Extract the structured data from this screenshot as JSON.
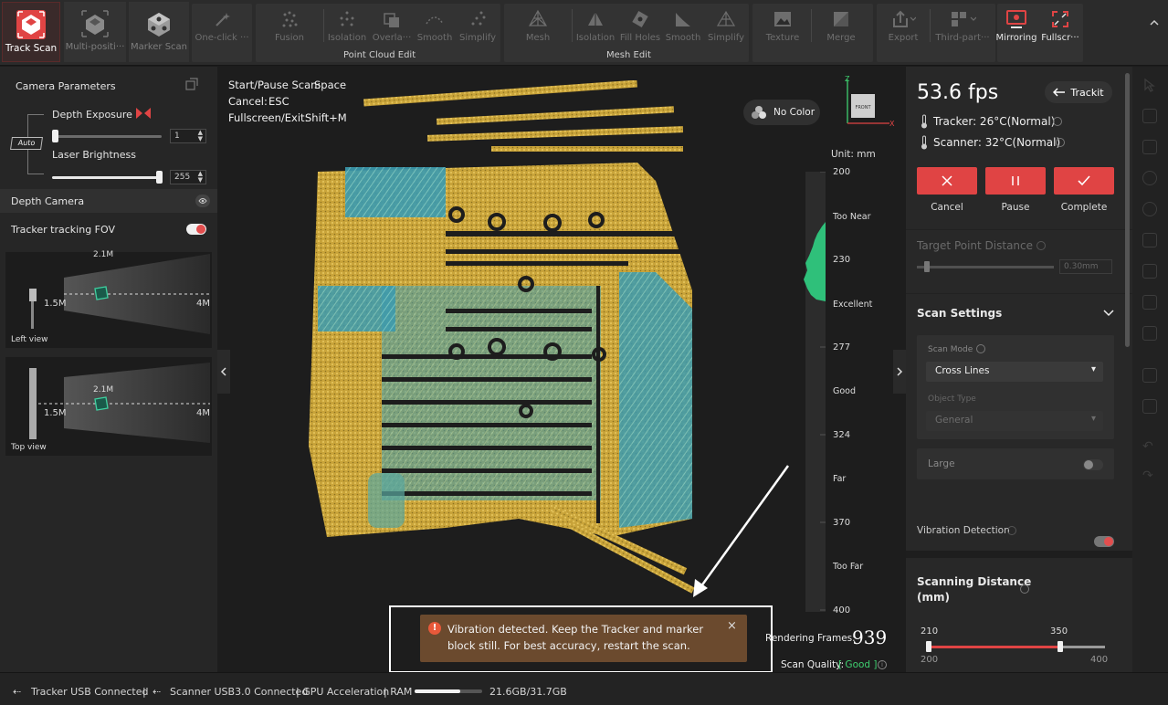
{
  "toolbar": {
    "track_scan": "Track Scan",
    "multi_position": "Multi-positi···",
    "marker_scan": "Marker Scan",
    "one_click": "One-click ···",
    "fusion": "Fusion",
    "pc_isolation": "Isolation",
    "pc_overlap": "Overla···",
    "pc_smooth": "Smooth",
    "pc_simplify": "Simplify",
    "point_cloud_edit": "Point Cloud Edit",
    "mesh": "Mesh",
    "mesh_isolation": "Isolation",
    "fill_holes": "Fill Holes",
    "mesh_smooth": "Smooth",
    "mesh_simplify": "Simplify",
    "mesh_edit": "Mesh Edit",
    "texture": "Texture",
    "merge": "Merge",
    "export": "Export",
    "third_party": "Third-part···",
    "mirroring": "Mirroring",
    "fullscreen": "Fullscr···",
    "accent": "#e04444"
  },
  "left": {
    "camera_parameters": "Camera Parameters",
    "depth_exposure": "Depth Exposure",
    "depth_exposure_value": "1",
    "auto": "Auto",
    "laser_brightness": "Laser Brightness",
    "laser_brightness_value": "255",
    "depth_camera": "Depth Camera",
    "tracker_fov": "Tracker tracking FOV",
    "left_view": "Left view",
    "top_view": "Top view",
    "near": "1.5M",
    "mid": "2.1M",
    "far": "4M"
  },
  "viewport": {
    "shortcut_scan_label": "Start/Pause Scan:",
    "shortcut_scan_key": "Space",
    "shortcut_cancel_label": "Cancel:",
    "shortcut_cancel_key": "ESC",
    "shortcut_full_label": "Fullscreen/Exit:",
    "shortcut_full_key": "Shift+M",
    "no_color": "No Color",
    "axis_z": "Z",
    "axis_x": "X",
    "cube_front": "FRONT",
    "unit": "Unit: mm",
    "ticks": [
      "200",
      "230",
      "277",
      "324",
      "370",
      "400"
    ],
    "zones": [
      "Too Near",
      "Excellent",
      "Good",
      "Far",
      "Too Far"
    ],
    "rendering_frames_label": "Rendering Frames:",
    "rendering_frames_value": "939",
    "scan_quality_label": "Scan Quality:",
    "scan_quality_value": "[ Good ]",
    "alert_text": "Vibration detected. Keep the Tracker and marker block still. For best accuracy, restart the scan."
  },
  "right": {
    "fps": "53.6 fps",
    "trackit": "Trackit",
    "tracker_temp": "Tracker: 26°C(Normal)",
    "scanner_temp": "Scanner: 32°C(Normal)",
    "cancel": "Cancel",
    "pause": "Pause",
    "complete": "Complete",
    "target_point_distance": "Target Point Distance",
    "target_point_value": "0.30mm",
    "scan_settings": "Scan Settings",
    "scan_mode_label": "Scan Mode",
    "scan_mode_value": "Cross Lines",
    "object_type_label": "Object Type",
    "object_type_value": "General",
    "large": "Large",
    "vibration_detection": "Vibration Detection",
    "scanning_distance": "Scanning Distance",
    "scanning_distance_unit": "(mm)",
    "dist_low": "210",
    "dist_high": "350",
    "dist_min": "200",
    "dist_max": "400"
  },
  "status": {
    "tracker_usb": "Tracker USB Connected",
    "sep1": "|",
    "scanner_usb": "Scanner USB3.0 Connected",
    "gpu": "| GPU Acceleration",
    "ram_label": "| RAM",
    "ram_value": "21.6GB/31.7GB",
    "ram_usage": 0.68
  }
}
